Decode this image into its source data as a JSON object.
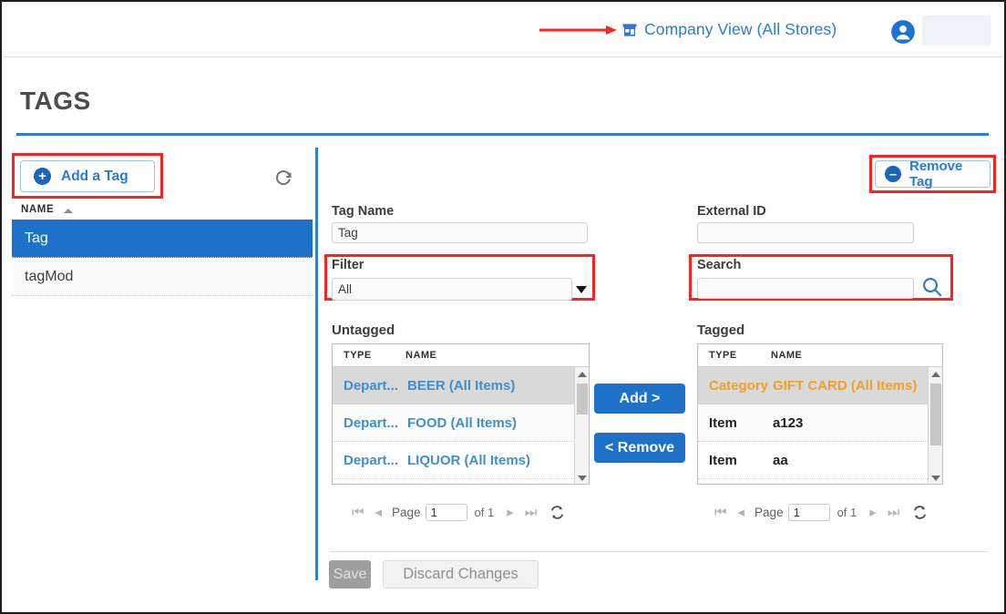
{
  "topbar": {
    "company_view_label": "Company View (All Stores)",
    "store_icon": "store-icon",
    "avatar_icon": "user-avatar-icon",
    "arrow_annotation": "red-arrow-annotation"
  },
  "page": {
    "title": "TAGS",
    "accent_color": "#2f7fd1",
    "highlight_color": "#fb2222"
  },
  "left_panel": {
    "add_tag_label": "Add a Tag",
    "add_tag_icon": "plus-circle-icon",
    "refresh_icon": "refresh-icon",
    "column_header": "NAME",
    "sort_direction": "asc",
    "tags": [
      {
        "name": "Tag",
        "selected": true
      },
      {
        "name": "tagMod",
        "selected": false
      }
    ]
  },
  "form": {
    "remove_tag_label": "Remove Tag",
    "remove_tag_icon": "minus-circle-icon",
    "tag_name_label": "Tag Name",
    "tag_name_value": "Tag",
    "external_id_label": "External ID",
    "external_id_value": "",
    "filter_label": "Filter",
    "filter_selected": "All",
    "filter_options": [
      "All"
    ],
    "search_label": "Search",
    "search_value": "",
    "search_icon": "search-magnifier-icon"
  },
  "untagged": {
    "caption": "Untagged",
    "columns": [
      "TYPE",
      "NAME"
    ],
    "rows": [
      {
        "type": "Depart...",
        "name": "BEER (All Items)",
        "selected": true
      },
      {
        "type": "Depart...",
        "name": "FOOD (All Items)",
        "selected": false
      },
      {
        "type": "Depart...",
        "name": "LIQUOR (All Items)",
        "selected": false
      }
    ],
    "pager": {
      "page_label": "Page",
      "page_value": "1",
      "of_label": "of 1"
    }
  },
  "tagged": {
    "caption": "Tagged",
    "columns": [
      "TYPE",
      "NAME"
    ],
    "rows": [
      {
        "type": "Category",
        "name": "GIFT CARD (All Items)",
        "selected": true
      },
      {
        "type": "Item",
        "name": "a123",
        "selected": false
      },
      {
        "type": "Item",
        "name": "aa",
        "selected": false
      }
    ],
    "pager": {
      "page_label": "Page",
      "page_value": "1",
      "of_label": "of 1"
    }
  },
  "transfer": {
    "add_label": "Add >",
    "remove_label": "< Remove"
  },
  "footer": {
    "save_label": "Save",
    "discard_label": "Discard Changes"
  }
}
